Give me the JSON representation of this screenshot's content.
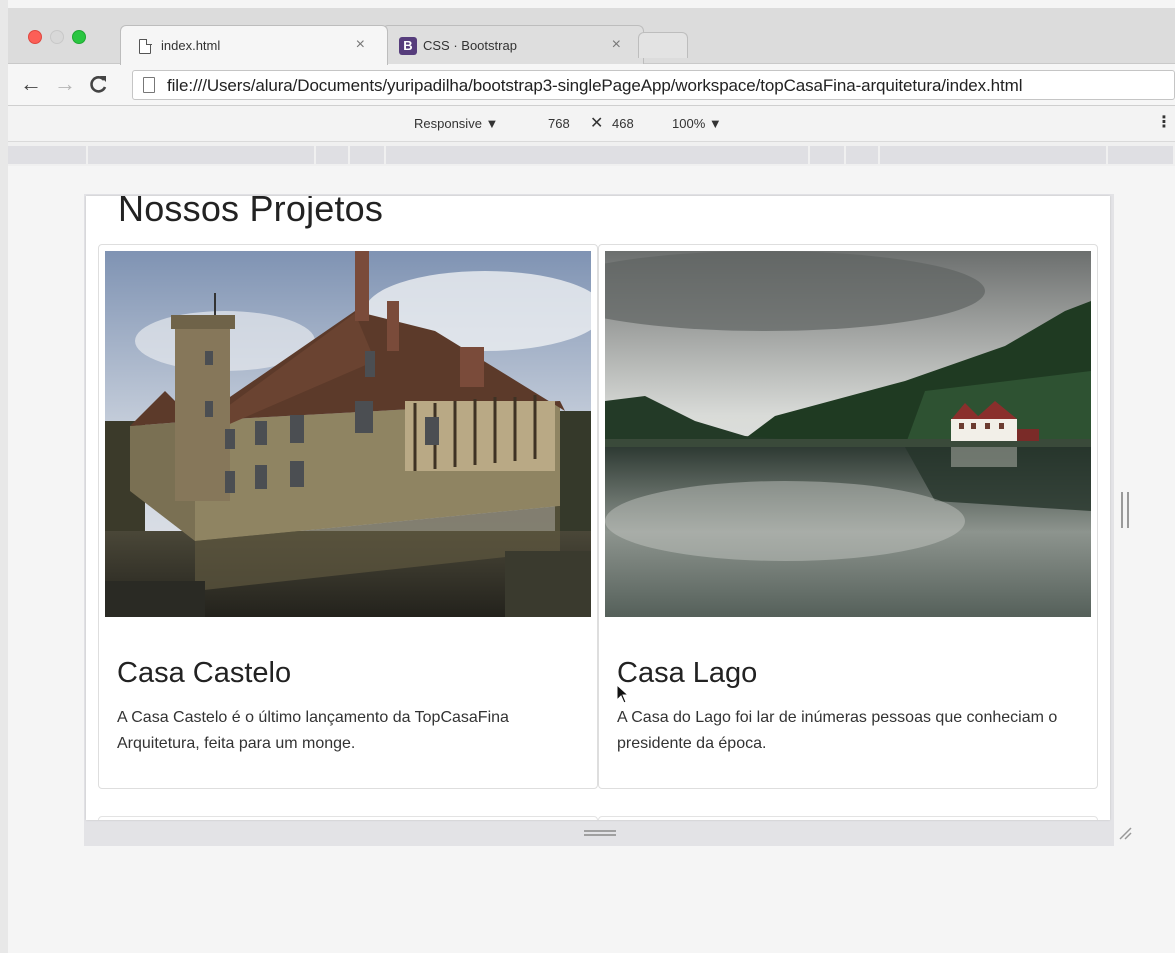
{
  "browser": {
    "tabs": [
      {
        "title": "index.html",
        "icon": "page-icon",
        "active": true
      },
      {
        "title": "CSS · Bootstrap",
        "icon": "bootstrap-icon",
        "active": false
      }
    ],
    "tab_close": "×",
    "url": "file:///Users/alura/Documents/yuripadilha/bootstrap3-singlePageApp/workspace/topCasaFina-arquitetura/index.html"
  },
  "devtools": {
    "mode": "Responsive ▼",
    "width": "768",
    "times": "✕",
    "height": "468",
    "zoom": "100% ▼",
    "menu": "⋮"
  },
  "page": {
    "heading": "Nossos Projetos",
    "projects": [
      {
        "title": "Casa Castelo",
        "description": "A Casa Castelo é o último lançamento da TopCasaFina Arquitetura, feita para um monge."
      },
      {
        "title": "Casa Lago",
        "description": "A Casa do Lago foi lar de inúmeras pessoas que conheciam o presidente da época."
      }
    ]
  },
  "colors": {
    "traffic_red": "#fc5f57",
    "traffic_green": "#2ac641",
    "bootstrap_purple": "#563d7c"
  }
}
